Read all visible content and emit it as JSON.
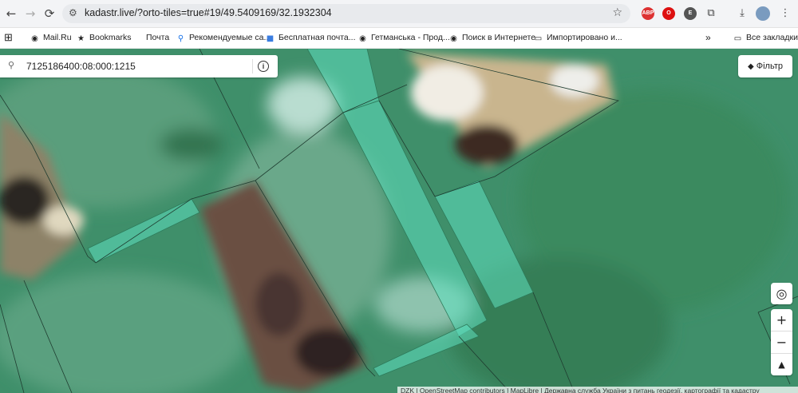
{
  "browser": {
    "url": "kadastr.live/?orto-tiles=true#19/49.5409169/32.1932304",
    "nav": {
      "back": "←",
      "forward": "→",
      "reload": "⟳"
    },
    "extensions": [
      {
        "name": "adblock-icon",
        "label": "ABP",
        "color": "#d33"
      },
      {
        "name": "opera-icon",
        "label": "O",
        "color": "#d11"
      },
      {
        "name": "extension-e-icon",
        "label": "E",
        "color": "#555"
      }
    ]
  },
  "bookmarks": {
    "apps_icon": "⊞",
    "items": [
      {
        "label": "Mail.Ru",
        "icon": "globe-icon",
        "glyph": "◉"
      },
      {
        "label": "Bookmarks",
        "icon": "star-icon",
        "glyph": "★"
      },
      {
        "label": "Почта",
        "icon": "blank-icon",
        "glyph": ""
      },
      {
        "label": "Рекомендуемые са...",
        "icon": "search-icon",
        "glyph": "⚲"
      },
      {
        "label": "Бесплатная почта...",
        "icon": "windows-icon",
        "glyph": "■"
      },
      {
        "label": "Гетманська - Прод...",
        "icon": "globe-icon",
        "glyph": "◉"
      },
      {
        "label": "Поиск в Интернете",
        "icon": "globe-icon",
        "glyph": "◉"
      },
      {
        "label": "Импортировано и...",
        "icon": "folder-icon",
        "glyph": "▭"
      }
    ],
    "overflow": "»",
    "all_bookmarks": "Все закладки"
  },
  "map": {
    "search_value": "7125186400:08:000:1215",
    "filter_label": "Фільтр",
    "controls": {
      "locate": "◎",
      "zoom_in": "+",
      "zoom_out": "−",
      "compass": "▲"
    },
    "attribution": "DZK | OpenStreetMap contributors | MapLibre | Державна служба України з питань геодезії, картографії та кадастру"
  },
  "colors": {
    "parcel_fill": "#5fe0c0",
    "terrain": "#3f8f6a",
    "accent": "#1a73e8"
  }
}
